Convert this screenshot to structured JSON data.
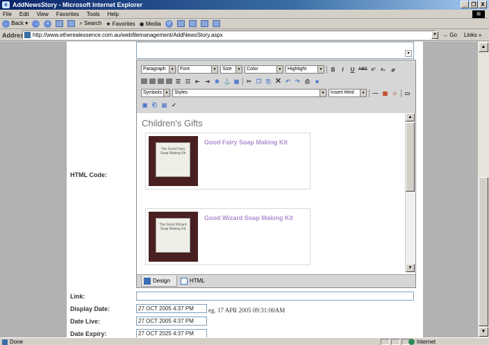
{
  "window": {
    "title": "AddNewsStory - Microsoft Internet Explorer",
    "controls": [
      "_",
      "❒",
      "X"
    ]
  },
  "menu": [
    "File",
    "Edit",
    "View",
    "Favorites",
    "Tools",
    "Help"
  ],
  "toolbar": {
    "back": "Back",
    "search": "Search",
    "favorites": "Favorites",
    "media": "Media"
  },
  "address": {
    "label": "Address",
    "url": "http://www.etherealessence.com.au/webfilemanagement/AddNewsStory.aspx",
    "go": "Go",
    "links": "Links"
  },
  "editor": {
    "row1": {
      "paragraph": "Paragraph",
      "font": "Font",
      "size": "Size",
      "color": "Color",
      "highlight": "Highlight",
      "bold": "B",
      "italic": "I",
      "underline": "U",
      "strike": "ABC",
      "superscript": "x²",
      "subscript": "x₂"
    },
    "row3": {
      "symbols": "Symbols",
      "styles": "Styles",
      "insert_html": "Insert Html"
    },
    "content": {
      "heading": "Children's Gifts",
      "products": [
        {
          "title": "Good Fairy Soap Making Kit",
          "photo_text": "The Good Fairy Soap Making Kit"
        },
        {
          "title": "Good Wizard Soap Making Kit",
          "photo_text": "The Good Wizard Soap Making Kit"
        }
      ]
    },
    "tabs": {
      "design": "Design",
      "html": "HTML"
    }
  },
  "form": {
    "html_code_label": "HTML Code:",
    "link_label": "Link:",
    "link_value": "",
    "display_date_label": "Display Date:",
    "display_date_value": "27 OCT 2005 4:37 PM",
    "date_hint": "eg. 17 APR 2005 09:31:00AM",
    "date_live_label": "Date Live:",
    "date_live_value": "27 OCT 2005 4:37 PM",
    "date_expiry_label": "Date Expiry:",
    "date_expiry_value": "27 OCT 2025 4:37 PM"
  },
  "status": {
    "text": "Done",
    "zone": "Internet"
  }
}
